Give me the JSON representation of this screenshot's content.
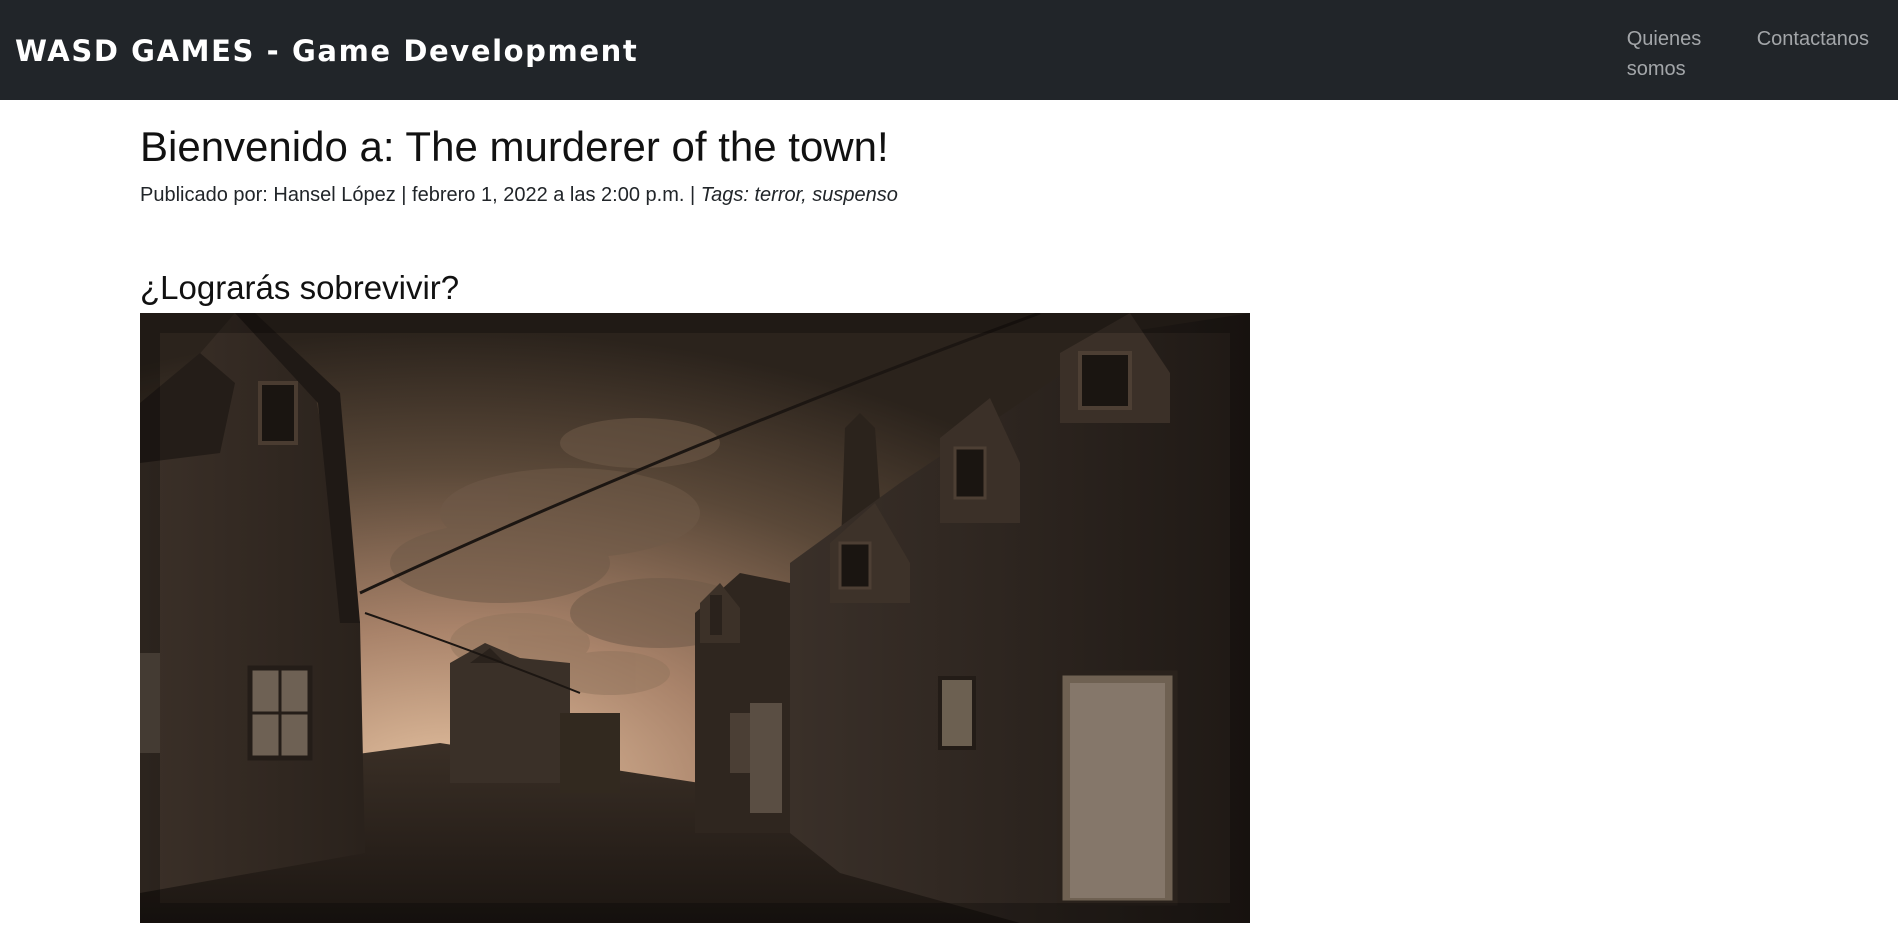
{
  "navbar": {
    "brand": "WASD GAMES - Game Development",
    "links": [
      {
        "label": "Quienes somos"
      },
      {
        "label": "Contactanos"
      }
    ]
  },
  "post": {
    "title": "Bienvenido a: The murderer of the town!",
    "meta": {
      "prefix": "Publicado por: Hansel López | febrero 1, 2022 a las 2:00 p.m. | ",
      "tags": "Tags: terror, suspenso"
    },
    "section_heading": "¿Lograrás sobrevivir?",
    "image": {
      "subject": "sepia street scene of an old town with houses at dusk",
      "palette": {
        "sky_light": "#d8b496",
        "sky_dark": "#2b231c",
        "buildings": "#2a221c",
        "ground": "#221b16"
      }
    }
  }
}
